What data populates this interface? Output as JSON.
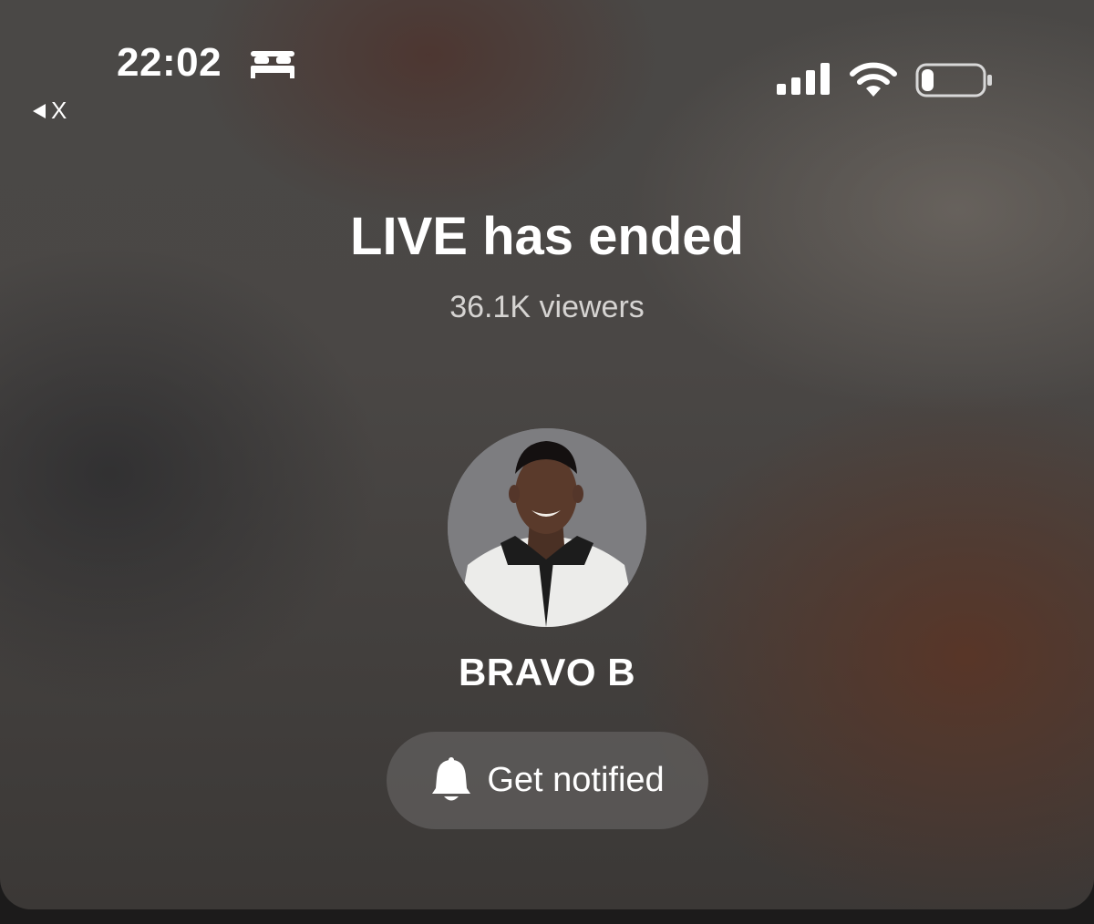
{
  "status_bar": {
    "time": "22:02",
    "back_app_label": "X",
    "icons": [
      "bed-icon",
      "signal-icon",
      "wifi-icon",
      "battery-icon"
    ],
    "battery_level": 0.2
  },
  "live": {
    "title": "LIVE has ended",
    "viewers": "36.1K viewers"
  },
  "host": {
    "name": "BRAVO B"
  },
  "notify": {
    "label": "Get notified",
    "icon": "bell-icon"
  },
  "colors": {
    "text": "#ffffff",
    "subtext": "#d6d4d2",
    "button_bg": "#6e6c6b"
  }
}
